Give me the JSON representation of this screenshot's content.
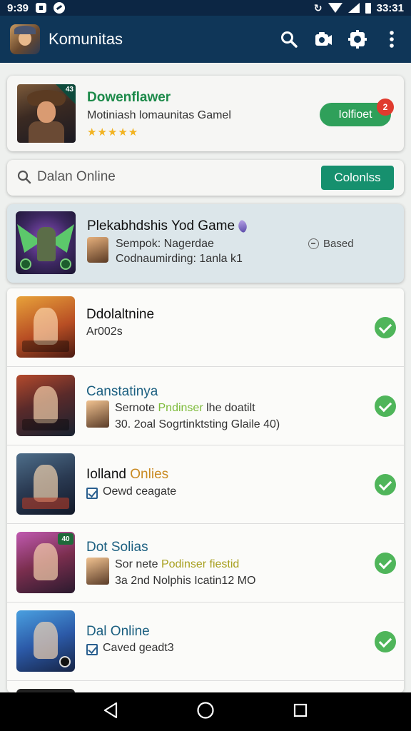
{
  "status_bar": {
    "time": "9:39",
    "clock_right": "33:31"
  },
  "app_bar": {
    "title": "Komunitas",
    "actions": [
      "search-icon",
      "camera-icon",
      "settings-icon",
      "more-vert-icon"
    ]
  },
  "featured": {
    "title": "Dowenflawer",
    "subtitle": "Motiniash lomaunitas Gamel",
    "stars": "★★★★★",
    "rating": 5,
    "corner_label": "43",
    "button_label": "Iolfioet",
    "badge": "2"
  },
  "search": {
    "text": "Dalan Online",
    "button_label": "Colonlss"
  },
  "highlight": {
    "title": "Plekabhdshis Yod Game",
    "line1": "Sempok: Nagerdae",
    "line2": "Codnaumirding: 1anla k1",
    "status": "Based"
  },
  "games": [
    {
      "name": "Ddolaltnine",
      "line1": "Ar002s",
      "checked": true,
      "colors": [
        "#d8832a",
        "#8a2e1e"
      ]
    },
    {
      "name": "Canstatinya",
      "line1_prefix": "Sernote",
      "line1_highlight": "Pndinser",
      "line1_suffix": "lhe doatilt",
      "line2": "30. 2oal Sogrtinktsting Glaile 40)",
      "checked": true,
      "colors": [
        "#7b3a2a",
        "#1e2a36"
      ]
    },
    {
      "name_part1": "Iolland",
      "name_part2": "Onlies",
      "line1": "Oewd ceagate",
      "checked": true,
      "colors": [
        "#3c5872",
        "#161e2c"
      ]
    },
    {
      "name": "Dot Solias",
      "line1_prefix": "Sor nete",
      "line1_highlight": "Podinser fiestid",
      "line2": "3a 2nd Nolphis Icatin12 MO",
      "corner_label": "40",
      "checked": true,
      "colors": [
        "#a05c8e",
        "#2e1e3a"
      ]
    },
    {
      "name": "Dal Online",
      "line1": "Caved geadt3",
      "checked": true,
      "colors": [
        "#3a7ac2",
        "#1c2e5a"
      ]
    }
  ]
}
